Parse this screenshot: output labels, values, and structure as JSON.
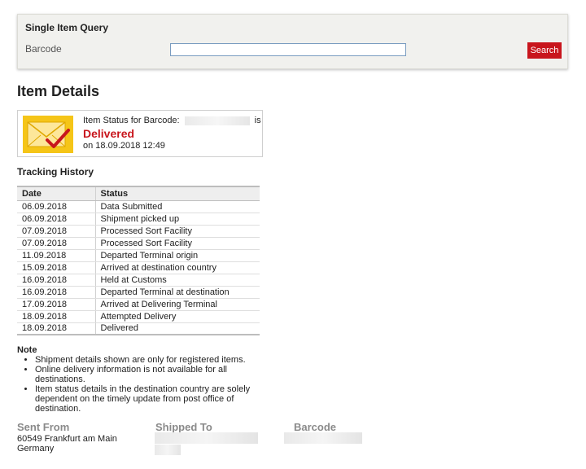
{
  "query": {
    "title": "Single Item Query",
    "barcode_label": "Barcode",
    "barcode_value": "",
    "search_label": "Search"
  },
  "details": {
    "title": "Item Details",
    "status_prefix": "Item Status for Barcode:",
    "status_suffix": "is",
    "status_value": "Delivered",
    "status_date": "on 18.09.2018 12:49",
    "icon": "envelope-check-icon"
  },
  "history": {
    "title": "Tracking History",
    "columns": [
      "Date",
      "Status"
    ],
    "rows": [
      [
        "06.09.2018",
        "Data Submitted"
      ],
      [
        "06.09.2018",
        "Shipment picked up"
      ],
      [
        "07.09.2018",
        "Processed Sort Facility"
      ],
      [
        "07.09.2018",
        "Processed Sort Facility"
      ],
      [
        "11.09.2018",
        "Departed Terminal origin"
      ],
      [
        "15.09.2018",
        "Arrived at destination country"
      ],
      [
        "16.09.2018",
        "Held at Customs"
      ],
      [
        "16.09.2018",
        "Departed Terminal at destination"
      ],
      [
        "17.09.2018",
        "Arrived at Delivering Terminal"
      ],
      [
        "18.09.2018",
        "Attempted Delivery"
      ],
      [
        "18.09.2018",
        "Delivered"
      ]
    ]
  },
  "note": {
    "title": "Note",
    "items": [
      "Shipment details shown are only for registered items.",
      "Online delivery information is not available for all destinations.",
      "Item status details in the destination country are solely dependent on the timely update from post office of destination."
    ]
  },
  "footer": {
    "sent_from_label": "Sent From",
    "sent_from_line1": "60549 Frankfurt am Main",
    "sent_from_line2": "Germany",
    "shipped_to_label": "Shipped To",
    "barcode_label": "Barcode"
  },
  "colors": {
    "accent": "#c8161d",
    "panel_bg": "#f1f1ee",
    "icon_yellow": "#f5c518"
  }
}
